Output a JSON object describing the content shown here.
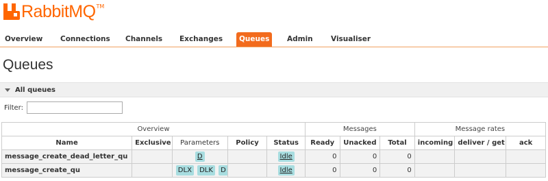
{
  "app": {
    "logo_text": "RabbitMQ",
    "logo_tm": "TM",
    "brand_color": "#ff6600",
    "active_tab_color": "#f26b1d",
    "badge_color": "#a8dde0"
  },
  "nav": {
    "tabs": [
      {
        "label": "Overview",
        "active": false
      },
      {
        "label": "Connections",
        "active": false
      },
      {
        "label": "Channels",
        "active": false
      },
      {
        "label": "Exchanges",
        "active": false
      },
      {
        "label": "Queues",
        "active": true
      },
      {
        "label": "Admin",
        "active": false
      },
      {
        "label": "Visualiser",
        "active": false
      }
    ]
  },
  "page": {
    "title": "Queues",
    "section_title": "All queues",
    "filter_label": "Filter:",
    "filter_value": ""
  },
  "table": {
    "groups": [
      "Overview",
      "Messages",
      "Message rates"
    ],
    "columns": [
      "Name",
      "Exclusive",
      "Parameters",
      "Policy",
      "Status",
      "Ready",
      "Unacked",
      "Total",
      "incoming",
      "deliver / get",
      "ack"
    ],
    "rows": [
      {
        "name": "message_create_dead_letter_qu",
        "exclusive": "",
        "parameters": [
          "D"
        ],
        "policy": "",
        "status": "Idle",
        "ready": "0",
        "unacked": "0",
        "total": "0",
        "incoming": "",
        "deliver_get": "",
        "ack": ""
      },
      {
        "name": "message_create_qu",
        "exclusive": "",
        "parameters": [
          "DLX",
          "DLK",
          "D"
        ],
        "policy": "",
        "status": "Idle",
        "ready": "0",
        "unacked": "0",
        "total": "0",
        "incoming": "",
        "deliver_get": "",
        "ack": ""
      }
    ]
  }
}
